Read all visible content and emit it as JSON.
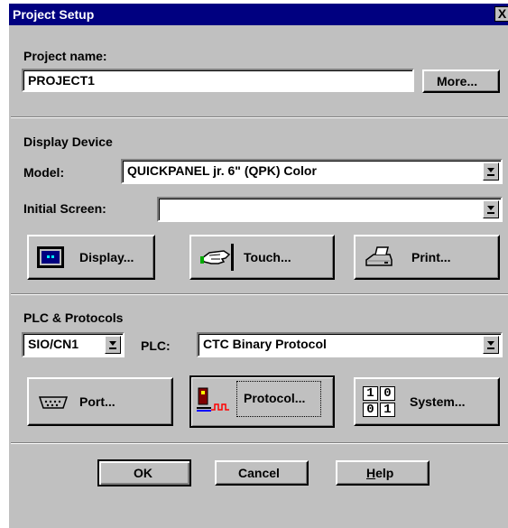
{
  "window": {
    "title": "Project Setup",
    "close_glyph": "X"
  },
  "project": {
    "label": "Project name:",
    "value": "PROJECT1",
    "more_button": "More..."
  },
  "display_device": {
    "section_title": "Display Device",
    "model_label": "Model:",
    "model_value": "QUICKPANEL jr. 6\" (QPK) Color",
    "initial_screen_label": "Initial Screen:",
    "initial_screen_value": "",
    "buttons": {
      "display": "Display...",
      "touch": "Touch...",
      "print": "Print..."
    }
  },
  "plc": {
    "section_title": "PLC & Protocols",
    "port_select_value": "SIO/CN1",
    "plc_label": "PLC:",
    "plc_value": "CTC Binary Protocol",
    "buttons": {
      "port": "Port...",
      "protocol": "Protocol...",
      "system": "System..."
    },
    "system_icon_digits": [
      "1",
      "0",
      "0",
      "1"
    ]
  },
  "footer": {
    "ok": "OK",
    "cancel": "Cancel",
    "help_mnemonic": "H",
    "help_rest": "elp"
  },
  "icons": [
    "close-icon",
    "monitor-icon",
    "touch-hand-icon",
    "printer-icon",
    "serial-port-icon",
    "protocol-icon",
    "binary-icon",
    "dropdown-arrow-icon"
  ]
}
